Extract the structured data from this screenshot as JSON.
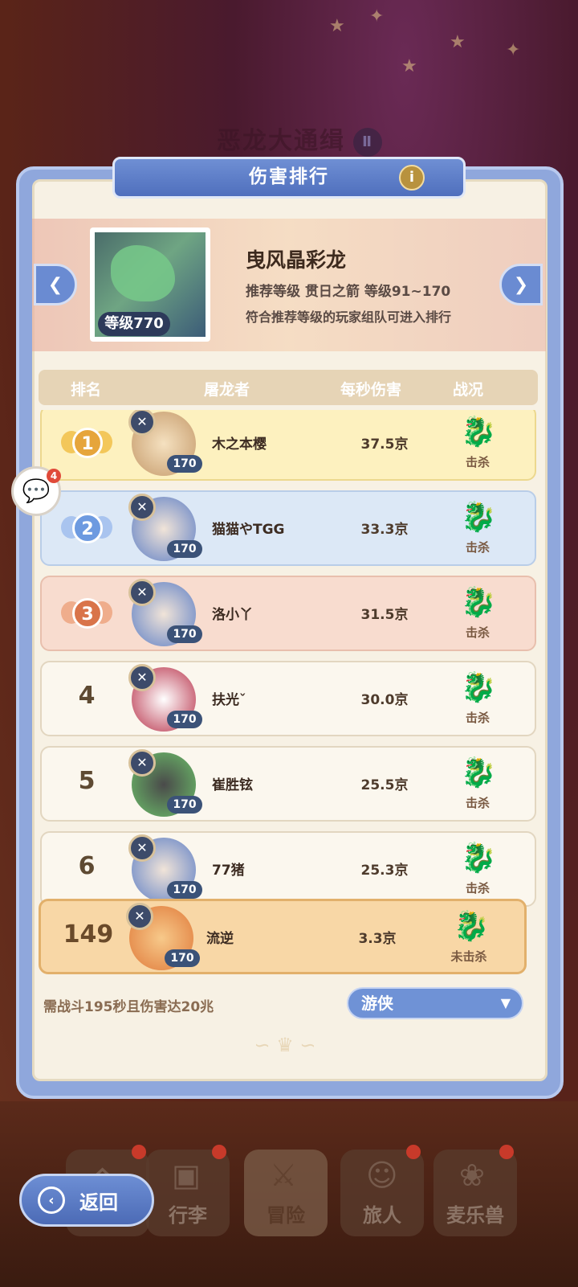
{
  "background": {
    "event_title": "恶龙大通缉",
    "event_volume": "Ⅱ"
  },
  "panel": {
    "title": "伤害排行"
  },
  "boss": {
    "name": "曳风晶彩龙",
    "level_label": "等级770",
    "recommend": "推荐等级  贯日之箭  等级91~170",
    "note": "符合推荐等级的玩家组队可进入排行"
  },
  "columns": {
    "rank": "排名",
    "player": "屠龙者",
    "dps": "每秒伤害",
    "status": "战况"
  },
  "rows": [
    {
      "rank": "1",
      "name": "木之本樱",
      "level": "170",
      "dps": "37.5京",
      "status": "击杀"
    },
    {
      "rank": "2",
      "name": "猫猫やTGG",
      "level": "170",
      "dps": "33.3京",
      "status": "击杀"
    },
    {
      "rank": "3",
      "name": "洛小丫",
      "level": "170",
      "dps": "31.5京",
      "status": "击杀"
    },
    {
      "rank": "4",
      "name": "扶光ˇ",
      "level": "170",
      "dps": "30.0京",
      "status": "击杀"
    },
    {
      "rank": "5",
      "name": "崔胜铉",
      "level": "170",
      "dps": "25.5京",
      "status": "击杀"
    },
    {
      "rank": "6",
      "name": "77猪",
      "level": "170",
      "dps": "25.3京",
      "status": "击杀"
    }
  ],
  "self_row": {
    "rank": "149",
    "name": "流逆",
    "level": "170",
    "dps": "3.3京",
    "status": "未击杀"
  },
  "footer": {
    "requirement": "需战斗195秒且伤害达20兆",
    "class_select": "游侠"
  },
  "chat": {
    "badge_count": "4"
  },
  "bottom_nav": {
    "back_label": "返回",
    "tabs": [
      {
        "label": ""
      },
      {
        "label": "行李"
      },
      {
        "label": "冒险"
      },
      {
        "label": "旅人"
      },
      {
        "label": "麦乐兽"
      }
    ]
  },
  "colors": {
    "accent": "#6f8fd4",
    "gold": "#e6a53b",
    "silver": "#6d9ae0",
    "bronze": "#d9744a",
    "panel": "#f7f1e4"
  },
  "icons": [
    "info-icon",
    "chevron-left-icon",
    "chevron-right-icon",
    "crossed-swords-icon",
    "dragon-icon",
    "chat-icon",
    "caret-down-icon",
    "back-arrow-icon"
  ]
}
